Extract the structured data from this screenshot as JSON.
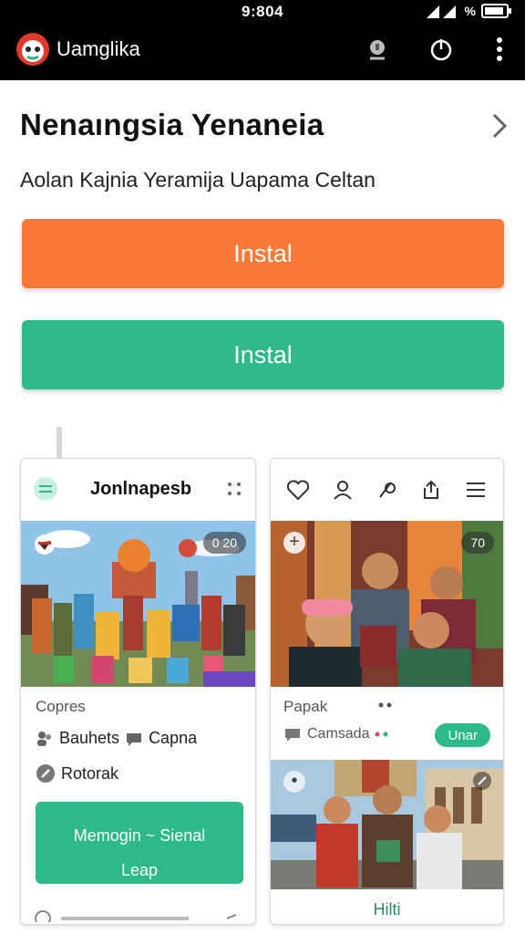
{
  "status_bar": {
    "time": "9:804",
    "battery_label": "%"
  },
  "app_bar": {
    "title": "Uamglika",
    "icons": [
      "logo-icon",
      "badge-icon",
      "power-icon",
      "more-vert-icon"
    ]
  },
  "header": {
    "title": "Nenaıngsia Yenaneia",
    "subtitle": "Aolan Kajnia  Yeramija Uapama Celtan"
  },
  "buttons": {
    "install_orange": "Instal",
    "install_green": "Instal"
  },
  "colors": {
    "orange": "#f97a36",
    "green": "#2db98c",
    "bar": "#000000"
  },
  "card_left": {
    "title": "Jonlnapesb",
    "photo_badge": "0 20",
    "section_label": "Copres",
    "meta": [
      {
        "icon": "people-icon",
        "label": "Bauhets"
      },
      {
        "icon": "chat-icon",
        "label": "Capna"
      },
      {
        "icon": "pen-icon",
        "label": "Rotorak"
      }
    ],
    "cta_line1": "Memogin ~ Sienal",
    "cta_line2": "Leap"
  },
  "card_right": {
    "icons": [
      "heart-icon",
      "user-icon",
      "edit-icon",
      "share-icon",
      "menu-icon"
    ],
    "photo_badge": "70",
    "section_label": "Papak",
    "comment_label": "Camsada",
    "pill_label": "Unar",
    "footer": "Hilti"
  }
}
